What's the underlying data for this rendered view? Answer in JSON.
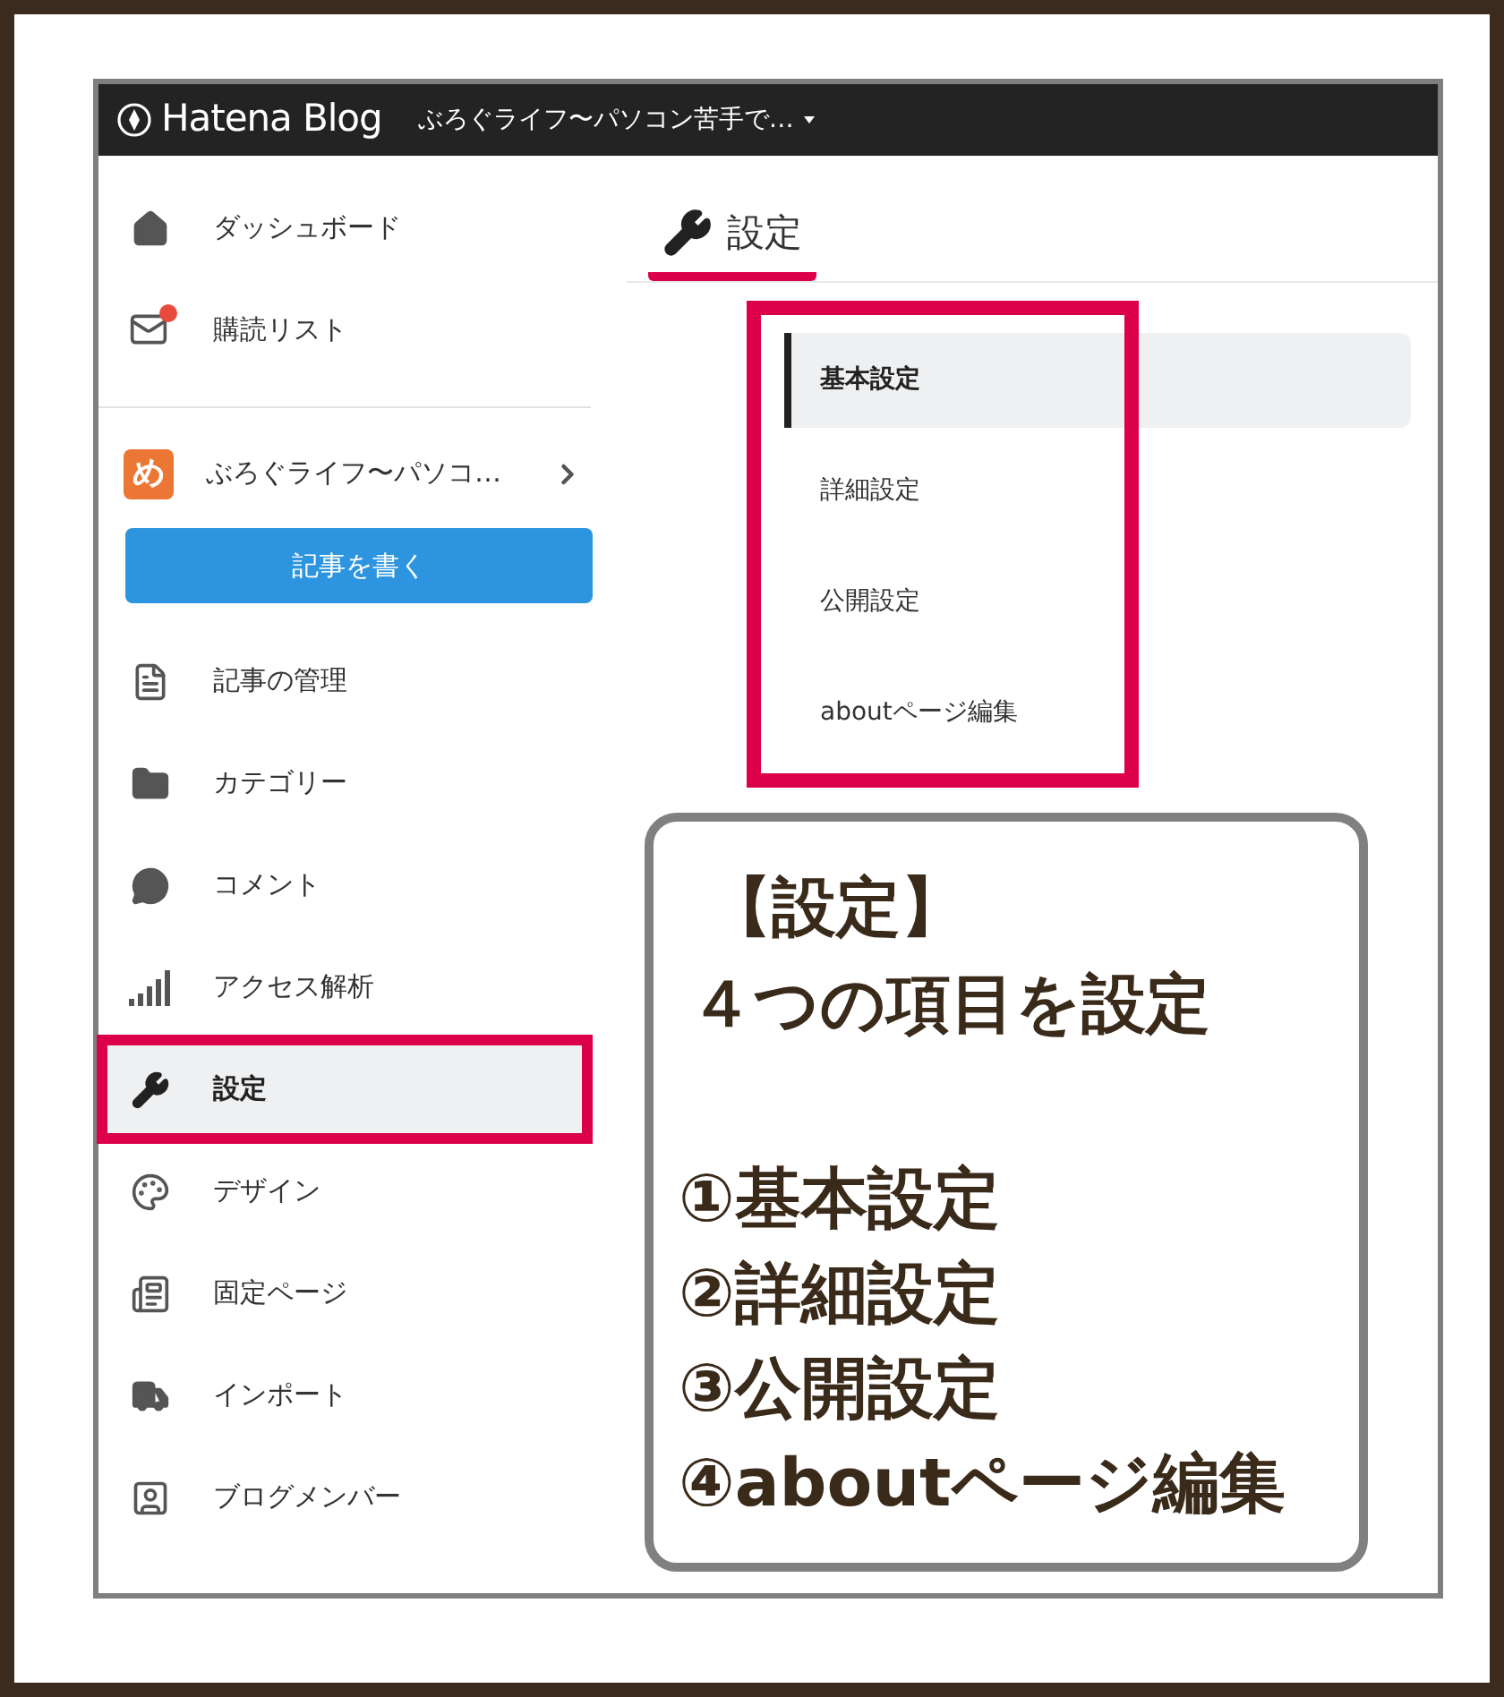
{
  "header": {
    "logo_text": "Hatena Blog",
    "blog_title": "ぶろぐライフ〜パソコン苦手で…"
  },
  "sidebar": {
    "top_items": [
      {
        "kind": "home",
        "label": "ダッシュボード"
      },
      {
        "kind": "mail",
        "label": "購読リスト",
        "badge": true
      }
    ],
    "blog": {
      "avatar_text": "め",
      "name": "ぶろぐライフ〜パソコ…"
    },
    "write_button": "記事を書く",
    "items": [
      {
        "kind": "file",
        "label": "記事の管理",
        "selected": false,
        "highlighted": false
      },
      {
        "kind": "folder",
        "label": "カテゴリー",
        "selected": false,
        "highlighted": false
      },
      {
        "kind": "comment",
        "label": "コメント",
        "selected": false,
        "highlighted": false
      },
      {
        "kind": "bars",
        "label": "アクセス解析",
        "selected": false,
        "highlighted": false
      },
      {
        "kind": "wrench",
        "label": "設定",
        "selected": true,
        "highlighted": true
      },
      {
        "kind": "palette",
        "label": "デザイン",
        "selected": false,
        "highlighted": false
      },
      {
        "kind": "page",
        "label": "固定ページ",
        "selected": false,
        "highlighted": false
      },
      {
        "kind": "truck",
        "label": "インポート",
        "selected": false,
        "highlighted": false
      },
      {
        "kind": "member",
        "label": "ブログメンバー",
        "selected": false,
        "highlighted": false
      }
    ]
  },
  "main": {
    "title": "設定",
    "title_underlined": true,
    "tabs_highlighted": true,
    "tabs": [
      {
        "label": "基本設定",
        "selected": true
      },
      {
        "label": "詳細設定",
        "selected": false
      },
      {
        "label": "公開設定",
        "selected": false
      },
      {
        "label": "aboutページ編集",
        "selected": false
      }
    ]
  },
  "callout": {
    "heading_lines": [
      "【設定】",
      "４つの項目を設定"
    ],
    "list": [
      "①基本設定",
      "②詳細設定",
      "③公開設定",
      "④aboutページ編集"
    ]
  }
}
